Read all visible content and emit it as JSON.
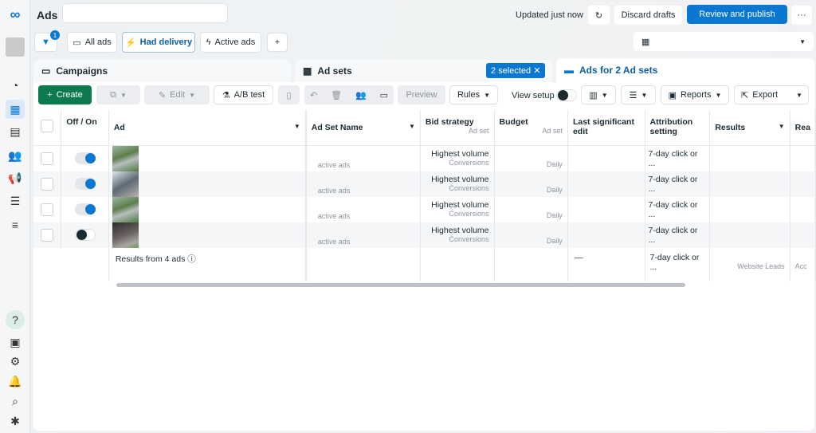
{
  "header": {
    "title": "Ads",
    "search_value": "",
    "updated": "Updated just now",
    "discard": "Discard drafts",
    "publish": "Review and publish",
    "more": "···"
  },
  "filters": {
    "badge": "1",
    "all_ads": "All ads",
    "had_delivery": "Had delivery",
    "active_ads": "Active ads",
    "add": "+"
  },
  "tabs": {
    "campaigns": "Campaigns",
    "adsets": "Ad sets",
    "selected": "2 selected",
    "ads": "Ads for 2 Ad sets"
  },
  "toolbar": {
    "create": "Create",
    "edit": "Edit",
    "ab_test": "A/B test",
    "preview": "Preview",
    "rules": "Rules",
    "view_setup": "View setup",
    "reports": "Reports",
    "export": "Export"
  },
  "table": {
    "headers": {
      "offon": "Off / On",
      "ad": "Ad",
      "adset": "Ad Set Name",
      "bid": "Bid strategy",
      "bid_sub": "Ad set",
      "budget": "Budget",
      "budget_sub": "Ad set",
      "last_edit": "Last significant edit",
      "attribution": "Attribution setting",
      "results": "Results",
      "reach": "Rea"
    },
    "rows": [
      {
        "on": true,
        "adset": "active ads",
        "bid": "Highest volume",
        "bid_sub": "Conversions",
        "budget": "Daily",
        "attribution": "7-day click or ..."
      },
      {
        "on": true,
        "adset": "active ads",
        "bid": "Highest volume",
        "bid_sub": "Conversions",
        "budget": "Daily",
        "attribution": "7-day click or ..."
      },
      {
        "on": true,
        "adset": "active ads",
        "bid": "Highest volume",
        "bid_sub": "Conversions",
        "budget": "Daily",
        "attribution": "7-day click or ..."
      },
      {
        "on": false,
        "adset": "active ads",
        "bid": "Highest volume",
        "bid_sub": "Conversions",
        "budget": "Daily",
        "attribution": "7-day click or ..."
      }
    ],
    "footer": {
      "label": "Results from 4 ads",
      "last_edit": "—",
      "attribution": "7-day click or ...",
      "results_sub": "Website Leads",
      "reach_sub": "Acc"
    }
  },
  "colors": {
    "accent": "#0a78d1",
    "create": "#0b7a4f"
  }
}
